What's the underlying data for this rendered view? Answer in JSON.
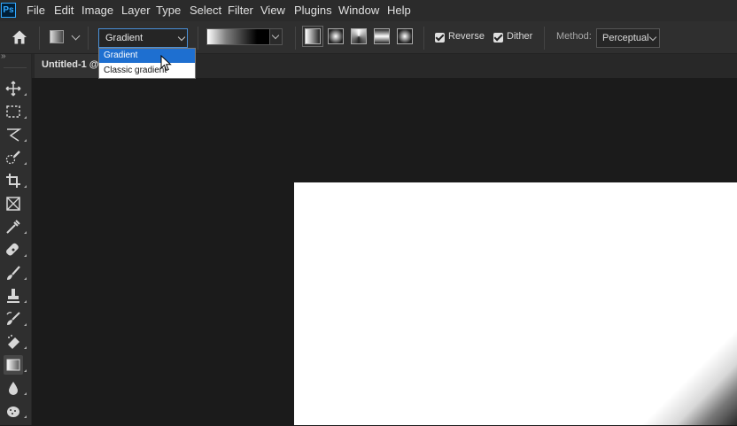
{
  "app": {
    "logo_text": "Ps"
  },
  "menubar": {
    "items": [
      "File",
      "Edit",
      "Image",
      "Layer",
      "Type",
      "Select",
      "Filter",
      "View",
      "Plugins",
      "Window",
      "Help"
    ]
  },
  "options": {
    "mode_select": {
      "value": "Gradient"
    },
    "reverse_label": "Reverse",
    "reverse_checked": true,
    "dither_label": "Dither",
    "dither_checked": true,
    "method_label": "Method:",
    "method_value": "Perceptual"
  },
  "dropdown": {
    "options": [
      "Gradient",
      "Classic gradient"
    ],
    "highlighted": "Gradient"
  },
  "document": {
    "tab_label": "Untitled-1 @"
  },
  "toolbar": {
    "tools": [
      "move-tool",
      "marquee-tool",
      "lasso-tool",
      "quick-selection-tool",
      "crop-tool",
      "frame-tool",
      "eyedropper-tool",
      "spot-healing-tool",
      "brush-tool",
      "clone-stamp-tool",
      "history-brush-tool",
      "eraser-tool",
      "gradient-tool",
      "blur-tool",
      "sponge-tool"
    ],
    "active_tool": "gradient-tool"
  },
  "colors": {
    "accent": "#1e6fd0",
    "select_border": "#4a90d9",
    "logo": "#31a8ff"
  }
}
